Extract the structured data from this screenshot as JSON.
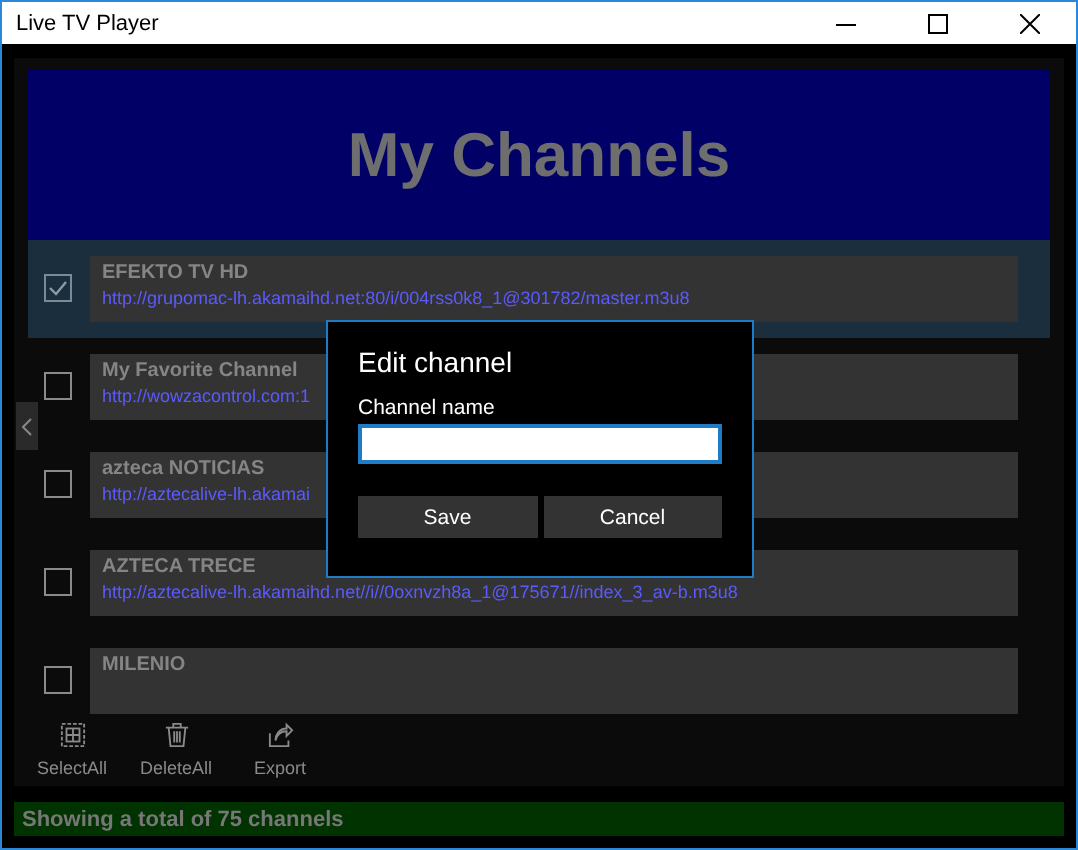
{
  "window": {
    "title": "Live TV Player"
  },
  "header": {
    "title": "My Channels"
  },
  "channels": [
    {
      "name": "EFEKTO TV HD",
      "url": "http://grupomac-lh.akamaihd.net:80/i/004rss0k8_1@301782/master.m3u8",
      "selected": true
    },
    {
      "name": "My Favorite Channel",
      "url": "http://wowzacontrol.com:1",
      "selected": false
    },
    {
      "name": "azteca NOTICIAS",
      "url": "http://aztecalive-lh.akamai",
      "selected": false
    },
    {
      "name": "AZTECA TRECE",
      "url": "http://aztecalive-lh.akamaihd.net//i//0oxnvzh8a_1@175671//index_3_av-b.m3u8",
      "selected": false
    },
    {
      "name": "MILENIO",
      "selected": false
    }
  ],
  "toolbar": [
    {
      "kind": "select",
      "label": "SelectAll"
    },
    {
      "kind": "delete",
      "label": "DeleteAll"
    },
    {
      "kind": "export",
      "label": "Export"
    }
  ],
  "status_bar": "Showing a total of 75 channels",
  "dialog": {
    "title": "Edit channel",
    "field_label": "Channel name",
    "buttons": [
      "Save",
      "Cancel"
    ]
  }
}
